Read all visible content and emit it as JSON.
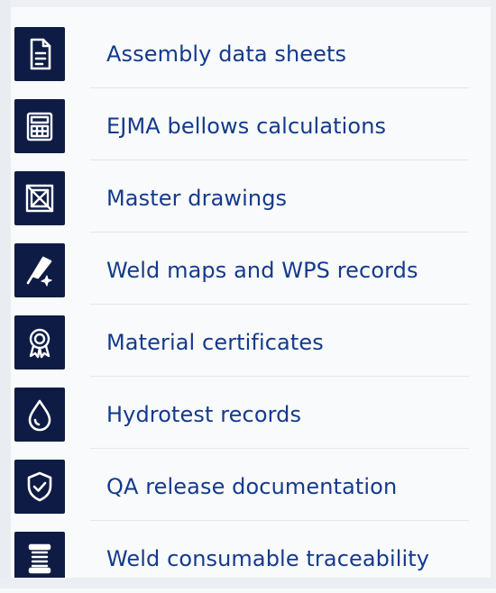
{
  "documents": [
    {
      "icon": "document-icon",
      "label": "Assembly data sheets"
    },
    {
      "icon": "calculator-icon",
      "label": "EJMA bellows calculations"
    },
    {
      "icon": "drawing-icon",
      "label": "Master drawings"
    },
    {
      "icon": "weld-torch-icon",
      "label": "Weld maps and WPS records"
    },
    {
      "icon": "certificate-icon",
      "label": "Material certificates"
    },
    {
      "icon": "water-drop-icon",
      "label": "Hydrotest records"
    },
    {
      "icon": "shield-check-icon",
      "label": "QA release documentation"
    },
    {
      "icon": "wire-spool-icon",
      "label": "Weld consumable traceability"
    }
  ],
  "colors": {
    "icon_tile": "#0e1c45",
    "label_text": "#133a8c",
    "background": "#f9fafb"
  }
}
